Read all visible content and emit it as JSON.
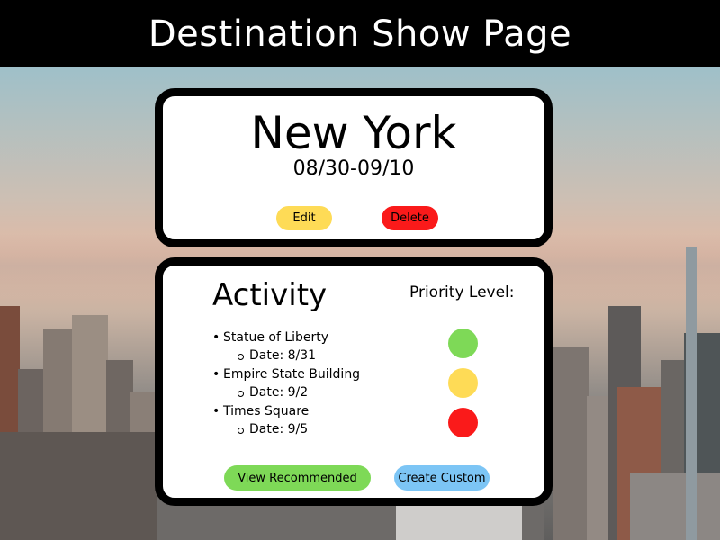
{
  "header": {
    "title": "Destination Show Page"
  },
  "destination": {
    "name": "New York",
    "dates": "08/30-09/10",
    "edit_label": "Edit",
    "delete_label": "Delete"
  },
  "activities_panel": {
    "title": "Activity",
    "priority_title": "Priority Level:",
    "items": [
      {
        "name": "Statue of Liberty",
        "date": "Date: 8/31",
        "priority_color": "#7ed957"
      },
      {
        "name": "Empire State Building",
        "date": "Date: 9/2",
        "priority_color": "#fedb56"
      },
      {
        "name": "Times Square",
        "date": "Date: 9/5",
        "priority_color": "#fa1a1a"
      }
    ],
    "recommended_label": "View Recommended",
    "custom_label": "Create Custom"
  },
  "colors": {
    "edit": "#fedb56",
    "delete": "#fa1a1a",
    "recommended": "#7ed957",
    "custom": "#7cc5f5"
  }
}
